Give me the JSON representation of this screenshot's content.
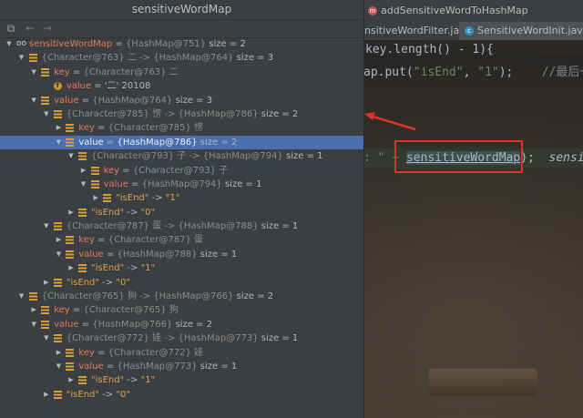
{
  "editor": {
    "tabs": [
      {
        "label": "addSensitiveWordToHashMap",
        "icon": "method-icon"
      },
      {
        "label": "nsitiveWordFilter.java",
        "icon": "java-class-icon"
      },
      {
        "label": "SensitiveWordInit.java",
        "icon": "java-class-icon"
      }
    ],
    "code_line1": "key.length() - 1){",
    "code_line2_a": "ap.put(",
    "code_line2_b": "\"isEnd\"",
    "code_line2_c": ", ",
    "code_line2_d": "\"1\"",
    "code_line2_e": ");",
    "code_line2_comment": "//最后一个",
    "code_line3_a": ": \" + ",
    "code_line3_b": "sensitiveWordMap",
    "code_line3_c": ");  ",
    "code_line3_d": "sensitiv"
  },
  "debug": {
    "title": "sensitiveWordMap",
    "tree": [
      {
        "indent": 0,
        "toggle": "▼",
        "icon": "glasses",
        "name": "sensitiveWordMap",
        "sep": " = ",
        "type": "{HashMap@751}",
        "tail": "  size = 2"
      },
      {
        "indent": 1,
        "toggle": "▼",
        "icon": "field",
        "type": "{Character@763} 二 -> {HashMap@764}",
        "tail": "  size = 3"
      },
      {
        "indent": 2,
        "toggle": "▼",
        "icon": "field",
        "name": "key",
        "sep": " = ",
        "type": "{Character@763} 二"
      },
      {
        "indent": 3,
        "toggle": "",
        "icon": "info",
        "name": "value",
        "sep": " = ",
        "tail": "'二' 20108"
      },
      {
        "indent": 2,
        "toggle": "▼",
        "icon": "field",
        "name": "value",
        "sep": " = ",
        "type": "{HashMap@764}",
        "tail": "  size = 3"
      },
      {
        "indent": 3,
        "toggle": "▼",
        "icon": "field",
        "type": "{Character@785} 愣 -> {HashMap@786}",
        "tail": "  size = 2"
      },
      {
        "indent": 4,
        "toggle": "▶",
        "icon": "field",
        "name": "key",
        "sep": " = ",
        "type": "{Character@785} 愣"
      },
      {
        "indent": 4,
        "toggle": "▼",
        "icon": "field",
        "name": "value",
        "sep": " = ",
        "type": "{HashMap@786}",
        "tail": "  size = 2",
        "selected": true
      },
      {
        "indent": 5,
        "toggle": "▼",
        "icon": "field",
        "type": "{Character@793} 子 -> {HashMap@794}",
        "tail": "  size = 1"
      },
      {
        "indent": 6,
        "toggle": "▶",
        "icon": "field",
        "name": "key",
        "sep": " = ",
        "type": "{Character@793} 子"
      },
      {
        "indent": 6,
        "toggle": "▼",
        "icon": "field",
        "name": "value",
        "sep": " = ",
        "type": "{HashMap@794}",
        "tail": "  size = 1"
      },
      {
        "indent": 7,
        "toggle": "▶",
        "icon": "field",
        "str": "\"isEnd\"",
        "sep": " -> ",
        "strval": "\"1\""
      },
      {
        "indent": 5,
        "toggle": "▶",
        "icon": "field",
        "str": "\"isEnd\"",
        "sep": " -> ",
        "strval": "\"0\""
      },
      {
        "indent": 3,
        "toggle": "▼",
        "icon": "field",
        "type": "{Character@787} 蛋 -> {HashMap@788}",
        "tail": "  size = 1"
      },
      {
        "indent": 4,
        "toggle": "▶",
        "icon": "field",
        "name": "key",
        "sep": " = ",
        "type": "{Character@787} 蛋"
      },
      {
        "indent": 4,
        "toggle": "▼",
        "icon": "field",
        "name": "value",
        "sep": " = ",
        "type": "{HashMap@788}",
        "tail": "  size = 1"
      },
      {
        "indent": 5,
        "toggle": "▶",
        "icon": "field",
        "str": "\"isEnd\"",
        "sep": " -> ",
        "strval": "\"1\""
      },
      {
        "indent": 3,
        "toggle": "▶",
        "icon": "field",
        "str": "\"isEnd\"",
        "sep": " -> ",
        "strval": "\"0\""
      },
      {
        "indent": 1,
        "toggle": "▼",
        "icon": "field",
        "type": "{Character@765} 狗 -> {HashMap@766}",
        "tail": "  size = 2"
      },
      {
        "indent": 2,
        "toggle": "▶",
        "icon": "field",
        "name": "key",
        "sep": " = ",
        "type": "{Character@765} 狗"
      },
      {
        "indent": 2,
        "toggle": "▼",
        "icon": "field",
        "name": "value",
        "sep": " = ",
        "type": "{HashMap@766}",
        "tail": "  size = 2"
      },
      {
        "indent": 3,
        "toggle": "▼",
        "icon": "field",
        "type": "{Character@772} 娃 -> {HashMap@773}",
        "tail": "  size = 1"
      },
      {
        "indent": 4,
        "toggle": "▶",
        "icon": "field",
        "name": "key",
        "sep": " = ",
        "type": "{Character@772} 娃"
      },
      {
        "indent": 4,
        "toggle": "▼",
        "icon": "field",
        "name": "value",
        "sep": " = ",
        "type": "{HashMap@773}",
        "tail": "  size = 1"
      },
      {
        "indent": 5,
        "toggle": "▶",
        "icon": "field",
        "str": "\"isEnd\"",
        "sep": " -> ",
        "strval": "\"1\""
      },
      {
        "indent": 3,
        "toggle": "▶",
        "icon": "field",
        "str": "\"isEnd\"",
        "sep": " -> ",
        "strval": "\"0\""
      }
    ]
  },
  "colors": {
    "selection": "#4b6eaf",
    "annotation_red": "#e0302c",
    "field_icon": "#d39f3c"
  }
}
